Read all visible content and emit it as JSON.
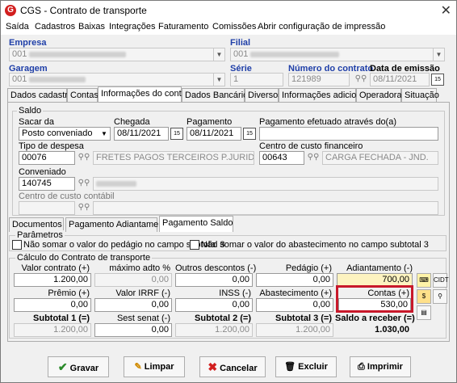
{
  "window": {
    "title": "CGS - Contrato de transporte",
    "close": "✕"
  },
  "menu": [
    "Saída",
    "Cadastros",
    "Baixas",
    "Integrações",
    "Faturamento",
    "Comissões",
    "Abrir configuração de impressão"
  ],
  "header": {
    "empresa_label": "Empresa",
    "empresa_value": "001",
    "filial_label": "Filial",
    "filial_value": "001",
    "garagem_label": "Garagem",
    "garagem_value": "001",
    "serie_label": "Série",
    "serie_value": "1",
    "numero_label": "Número do contrato",
    "numero_value": "121989",
    "data_label": "Data de emissão",
    "data_value": "08/11/2021"
  },
  "tabs": [
    "Dados cadastrais",
    "Contas",
    "Informações do contrato",
    "Dados Bancários",
    "Diversos",
    "Informações adicionais",
    "Operadoras",
    "Situação"
  ],
  "saldo": {
    "group": "Saldo",
    "sacar_label": "Sacar da",
    "sacar_value": "Posto conveniado",
    "chegada_label": "Chegada",
    "chegada_value": "08/11/2021",
    "pagamento_label": "Pagamento",
    "pagamento_value": "08/11/2021",
    "pag_efetuado_label": "Pagamento efetuado através do(a)",
    "pag_efetuado_value": "",
    "tipo_despesa_label": "Tipo de despesa",
    "tipo_despesa_code": "00076",
    "tipo_despesa_desc": "FRETES PAGOS TERCEIROS P.JURIDICA",
    "centro_fin_label": "Centro de custo financeiro",
    "centro_fin_code": "00643",
    "centro_fin_desc": "CARGA FECHADA - JND.",
    "conveniado_label": "Conveniado",
    "conveniado_code": "140745",
    "centro_contabil_label": "Centro de custo contábil"
  },
  "subtabs": [
    "Documentos",
    "Pagamento Adiantamento",
    "Pagamento Saldo"
  ],
  "parametros": {
    "group": "Parâmetros",
    "chk1": "Não somar o valor do pedágio no campo subtotal 3",
    "chk2": "Não somar o valor do abastecimento no campo subtotal 3"
  },
  "calculo": {
    "group": "Cálculo do Contrato de transporte",
    "row1": [
      {
        "label": "Valor contrato (+)",
        "value": "1.200,00"
      },
      {
        "label": "máximo adto %",
        "value": "0,00"
      },
      {
        "label": "Outros descontos (-)",
        "value": "0,00"
      },
      {
        "label": "Pedágio (+)",
        "value": "0,00"
      },
      {
        "label": "Adiantamento (-)",
        "value": "700,00"
      }
    ],
    "row2": [
      {
        "label": "Prêmio (+)",
        "value": "0,00"
      },
      {
        "label": "Valor IRRF (-)",
        "value": "0,00"
      },
      {
        "label": "INSS (-)",
        "value": "0,00"
      },
      {
        "label": "Abastecimento (+)",
        "value": "0,00"
      },
      {
        "label": "Contas (+)",
        "value": "530,00"
      }
    ],
    "row3": [
      {
        "label": "Subtotal 1 (=)",
        "value": "1.200,00"
      },
      {
        "label": "Sest senat (-)",
        "value": "0,00"
      },
      {
        "label": "Subtotal 2 (=)",
        "value": "1.200,00"
      },
      {
        "label": "Subtotal 3 (=)",
        "value": "1.200,00"
      },
      {
        "label": "Saldo a receber (=)",
        "value": "1.030,00"
      }
    ]
  },
  "buttons": {
    "gravar": "Gravar",
    "limpar": "Limpar",
    "cancelar": "Cancelar",
    "excluir": "Excluir",
    "imprimir": "Imprimir"
  },
  "colors": {
    "label_blue": "#1f3fa8",
    "adiantamento_bg": "#fdf3c0",
    "highlight": "#c8182a",
    "logo_red": "#d21f1f"
  },
  "icons": {
    "search": "binoculars-icon",
    "calendar": "calendar-icon"
  }
}
